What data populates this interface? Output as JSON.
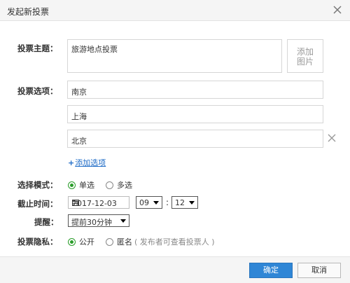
{
  "dialog": {
    "title": "发起新投票"
  },
  "form": {
    "topic_label": "投票主题：",
    "topic_value": "旅游地点投票",
    "add_image_label_1": "添加",
    "add_image_label_2": "图片",
    "options_label": "投票选项：",
    "options": [
      "南京",
      "上海",
      "北京"
    ],
    "add_option_plus": "+",
    "add_option_text": "添加选项",
    "mode_label": "选择模式：",
    "mode_single": "单选",
    "mode_multi": "多选",
    "deadline_label": "截止时间：",
    "deadline_date": "2017-12-03",
    "deadline_hour": "09",
    "deadline_minute": "12",
    "time_colon": ":",
    "reminder_label": "提醒：",
    "reminder_value": "提前30分钟",
    "privacy_label": "投票隐私：",
    "privacy_public": "公开",
    "privacy_anonymous": "匿名",
    "privacy_anonymous_hint": "( 发布者可查看投票人 )"
  },
  "footer": {
    "ok_label": "确定",
    "cancel_label": "取消"
  },
  "colors": {
    "accent": "#2f86d6",
    "link": "#1f6cc7",
    "radio_selected": "#2a9d2a"
  },
  "icons": [
    "close-icon",
    "remove-option-icon",
    "calendar-icon",
    "dropdown-arrow-icon"
  ]
}
